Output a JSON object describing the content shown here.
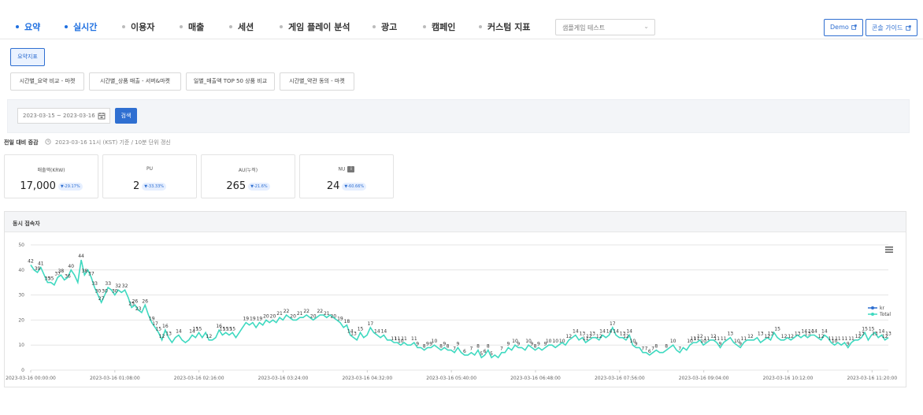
{
  "nav": {
    "items": [
      {
        "label": "요약",
        "active": true
      },
      {
        "label": "실시간",
        "active": true
      },
      {
        "label": "이용자",
        "active": false
      },
      {
        "label": "매출",
        "active": false
      },
      {
        "label": "세션",
        "active": false
      },
      {
        "label": "게임 플레이 분석",
        "active": false
      },
      {
        "label": "광고",
        "active": false
      },
      {
        "label": "캠페인",
        "active": false
      },
      {
        "label": "커스텀 지표",
        "active": false
      }
    ],
    "project_select": "샘플게임 테스트",
    "demo_label": "Demo",
    "guide_label": "콘솔 가이드"
  },
  "summary_button": "요약지표",
  "report_buttons": [
    "시간별_요약 비교 - 마켓",
    "시간별_상품 매출 - 서버&마켓",
    "일별_매출액 TOP 50 상품 비교",
    "시간별_약관 동의 - 마켓"
  ],
  "filter": {
    "date_range": "2023-03-15 ~ 2023-03-16",
    "search_label": "검색"
  },
  "compare": {
    "title": "전일 대비 증감",
    "note": "2023-03-16 11시 (KST) 기준 / 10분 단위 갱신"
  },
  "kpis": [
    {
      "label": "매출액(KRW)",
      "value": "17,000",
      "change": "▼-29.17%",
      "info": false
    },
    {
      "label": "PU",
      "value": "2",
      "change": "▼-33.33%",
      "info": false
    },
    {
      "label": "AU(누적)",
      "value": "265",
      "change": "▼-21.6%",
      "info": false
    },
    {
      "label": "NU",
      "value": "24",
      "change": "▼-60.66%",
      "info": true
    }
  ],
  "chart_data": {
    "type": "line",
    "title": "동시 접속자",
    "ylim": [
      0,
      50
    ],
    "yticks": [
      0,
      10,
      20,
      30,
      40,
      50
    ],
    "xtick_labels": [
      "2023-03-16 00:00:00",
      "2023-03-16 01:08:00",
      "2023-03-16 02:16:00",
      "2023-03-16 03:24:00",
      "2023-03-16 04:32:00",
      "2023-03-16 05:40:00",
      "2023-03-16 06:48:00",
      "2023-03-16 07:56:00",
      "2023-03-16 09:04:00",
      "2023-03-16 10:12:00",
      "2023-03-16 11:20:00"
    ],
    "legend": [
      "kr",
      "Total"
    ],
    "legend_position": "right",
    "grid": true,
    "colors": {
      "kr": "#2f6fd1",
      "Total": "#3fd9c0"
    },
    "series": [
      {
        "name": "Total",
        "values": [
          42,
          40,
          39,
          41,
          38,
          35,
          35,
          34,
          37,
          38,
          36,
          37,
          40,
          38,
          35,
          44,
          38,
          40,
          37,
          33,
          30,
          27,
          30,
          33,
          32,
          30,
          32,
          31,
          32,
          29,
          25,
          26,
          24,
          23,
          26,
          22,
          19,
          17,
          15,
          12,
          16,
          13,
          11,
          13,
          14,
          12,
          11,
          12,
          14,
          13,
          15,
          13,
          15,
          12,
          12,
          13,
          16,
          14,
          15,
          14,
          15,
          13,
          15,
          17,
          19,
          18,
          19,
          17,
          19,
          18,
          20,
          19,
          20,
          19,
          21,
          20,
          22,
          21,
          20,
          20,
          21,
          21,
          22,
          21,
          20,
          21,
          22,
          22,
          21,
          22,
          21,
          20,
          19,
          17,
          18,
          14,
          13,
          12,
          15,
          13,
          14,
          17,
          15,
          14,
          13,
          14,
          12,
          12,
          11,
          11,
          10,
          11,
          10,
          10,
          11,
          9,
          9,
          8,
          9,
          9,
          10,
          9,
          8,
          9,
          8,
          8,
          7,
          9,
          7,
          6,
          6,
          7,
          6,
          8,
          5,
          6,
          8,
          5,
          6,
          5,
          7,
          7,
          9,
          8,
          10,
          9,
          9,
          8,
          10,
          9,
          8,
          9,
          8,
          9,
          10,
          10,
          9,
          10,
          11,
          10,
          12,
          13,
          14,
          12,
          13,
          11,
          12,
          13,
          13,
          12,
          14,
          13,
          14,
          17,
          14,
          13,
          13,
          12,
          14,
          10,
          9,
          9,
          7,
          7,
          6,
          7,
          8,
          7,
          7,
          8,
          9,
          10,
          8,
          7,
          9,
          8,
          10,
          11,
          11,
          12,
          10,
          11,
          12,
          12,
          11,
          9,
          11,
          12,
          13,
          11,
          10,
          9,
          11,
          12,
          12,
          12,
          13,
          11,
          12,
          13,
          12,
          15,
          13,
          12,
          12,
          13,
          12,
          13,
          14,
          13,
          14,
          13,
          14,
          14,
          13,
          12,
          14,
          13,
          11,
          10,
          11,
          10,
          11,
          9,
          11,
          12,
          12,
          13,
          15,
          12,
          14,
          15,
          13,
          14,
          12,
          13
        ]
      },
      {
        "name": "kr",
        "values": []
      }
    ],
    "point_labels": [
      {
        "i": 0,
        "v": 42
      },
      {
        "i": 2,
        "v": 39
      },
      {
        "i": 3,
        "v": 41
      },
      {
        "i": 5,
        "v": 35
      },
      {
        "i": 6,
        "v": 35
      },
      {
        "i": 8,
        "v": 37
      },
      {
        "i": 9,
        "v": 38
      },
      {
        "i": 11,
        "v": 36
      },
      {
        "i": 12,
        "v": 40
      },
      {
        "i": 15,
        "v": 44
      },
      {
        "i": 16,
        "v": 38
      },
      {
        "i": 18,
        "v": 37
      },
      {
        "i": 19,
        "v": 33
      },
      {
        "i": 20,
        "v": 30
      },
      {
        "i": 21,
        "v": 27
      },
      {
        "i": 22,
        "v": 30
      },
      {
        "i": 23,
        "v": 33
      },
      {
        "i": 25,
        "v": 30
      },
      {
        "i": 26,
        "v": 32
      },
      {
        "i": 28,
        "v": 32
      },
      {
        "i": 30,
        "v": 25
      },
      {
        "i": 31,
        "v": 26
      },
      {
        "i": 32,
        "v": 23
      },
      {
        "i": 34,
        "v": 26
      },
      {
        "i": 36,
        "v": 19
      },
      {
        "i": 37,
        "v": 17
      },
      {
        "i": 38,
        "v": 15
      },
      {
        "i": 39,
        "v": 12
      },
      {
        "i": 40,
        "v": 16
      },
      {
        "i": 41,
        "v": 13
      },
      {
        "i": 44,
        "v": 14
      },
      {
        "i": 48,
        "v": 14
      },
      {
        "i": 49,
        "v": 15
      },
      {
        "i": 50,
        "v": 15
      },
      {
        "i": 53,
        "v": 12
      },
      {
        "i": 56,
        "v": 16
      },
      {
        "i": 57,
        "v": 15
      },
      {
        "i": 58,
        "v": 15
      },
      {
        "i": 59,
        "v": 15
      },
      {
        "i": 60,
        "v": 15
      },
      {
        "i": 64,
        "v": 19
      },
      {
        "i": 66,
        "v": 19
      },
      {
        "i": 68,
        "v": 19
      },
      {
        "i": 70,
        "v": 20
      },
      {
        "i": 72,
        "v": 20
      },
      {
        "i": 74,
        "v": 21
      },
      {
        "i": 76,
        "v": 22
      },
      {
        "i": 78,
        "v": 20
      },
      {
        "i": 80,
        "v": 21
      },
      {
        "i": 82,
        "v": 22
      },
      {
        "i": 84,
        "v": 20
      },
      {
        "i": 86,
        "v": 22
      },
      {
        "i": 88,
        "v": 21
      },
      {
        "i": 90,
        "v": 20
      },
      {
        "i": 92,
        "v": 19
      },
      {
        "i": 94,
        "v": 18
      },
      {
        "i": 95,
        "v": 14
      },
      {
        "i": 96,
        "v": 13
      },
      {
        "i": 98,
        "v": 15
      },
      {
        "i": 101,
        "v": 17
      },
      {
        "i": 103,
        "v": 14
      },
      {
        "i": 105,
        "v": 14
      },
      {
        "i": 108,
        "v": 11
      },
      {
        "i": 109,
        "v": 11
      },
      {
        "i": 110,
        "v": 10
      },
      {
        "i": 111,
        "v": 11
      },
      {
        "i": 114,
        "v": 11
      },
      {
        "i": 115,
        "v": 9
      },
      {
        "i": 117,
        "v": 8
      },
      {
        "i": 118,
        "v": 9
      },
      {
        "i": 119,
        "v": 9
      },
      {
        "i": 120,
        "v": 10
      },
      {
        "i": 122,
        "v": 8
      },
      {
        "i": 123,
        "v": 9
      },
      {
        "i": 124,
        "v": 8
      },
      {
        "i": 126,
        "v": 7
      },
      {
        "i": 127,
        "v": 9
      },
      {
        "i": 129,
        "v": 6
      },
      {
        "i": 131,
        "v": 7
      },
      {
        "i": 133,
        "v": 8
      },
      {
        "i": 134,
        "v": 5
      },
      {
        "i": 135,
        "v": 6
      },
      {
        "i": 136,
        "v": 8
      },
      {
        "i": 137,
        "v": 5
      },
      {
        "i": 140,
        "v": 7
      },
      {
        "i": 142,
        "v": 9
      },
      {
        "i": 144,
        "v": 10
      },
      {
        "i": 145,
        "v": 9
      },
      {
        "i": 148,
        "v": 10
      },
      {
        "i": 149,
        "v": 9
      },
      {
        "i": 150,
        "v": 8
      },
      {
        "i": 151,
        "v": 9
      },
      {
        "i": 153,
        "v": 9
      },
      {
        "i": 154,
        "v": 10
      },
      {
        "i": 156,
        "v": 10
      },
      {
        "i": 158,
        "v": 10
      },
      {
        "i": 160,
        "v": 12
      },
      {
        "i": 162,
        "v": 14
      },
      {
        "i": 164,
        "v": 13
      },
      {
        "i": 165,
        "v": 11
      },
      {
        "i": 166,
        "v": 12
      },
      {
        "i": 167,
        "v": 13
      },
      {
        "i": 169,
        "v": 12
      },
      {
        "i": 170,
        "v": 14
      },
      {
        "i": 172,
        "v": 14
      },
      {
        "i": 173,
        "v": 17
      },
      {
        "i": 174,
        "v": 14
      },
      {
        "i": 176,
        "v": 13
      },
      {
        "i": 177,
        "v": 12
      },
      {
        "i": 178,
        "v": 14
      },
      {
        "i": 179,
        "v": 10
      },
      {
        "i": 180,
        "v": 9
      },
      {
        "i": 182,
        "v": 7
      },
      {
        "i": 183,
        "v": 7
      },
      {
        "i": 184,
        "v": 6
      },
      {
        "i": 185,
        "v": 7
      },
      {
        "i": 186,
        "v": 8
      },
      {
        "i": 189,
        "v": 8
      },
      {
        "i": 191,
        "v": 10
      },
      {
        "i": 193,
        "v": 7
      },
      {
        "i": 196,
        "v": 10
      },
      {
        "i": 197,
        "v": 11
      },
      {
        "i": 198,
        "v": 11
      },
      {
        "i": 199,
        "v": 12
      },
      {
        "i": 200,
        "v": 10
      },
      {
        "i": 201,
        "v": 11
      },
      {
        "i": 203,
        "v": 12
      },
      {
        "i": 204,
        "v": 11
      },
      {
        "i": 205,
        "v": 9
      },
      {
        "i": 206,
        "v": 11
      },
      {
        "i": 208,
        "v": 13
      },
      {
        "i": 210,
        "v": 10
      },
      {
        "i": 211,
        "v": 9
      },
      {
        "i": 212,
        "v": 11
      },
      {
        "i": 214,
        "v": 12
      },
      {
        "i": 217,
        "v": 13
      },
      {
        "i": 219,
        "v": 12
      },
      {
        "i": 220,
        "v": 13
      },
      {
        "i": 222,
        "v": 15
      },
      {
        "i": 224,
        "v": 12
      },
      {
        "i": 226,
        "v": 12
      },
      {
        "i": 228,
        "v": 13
      },
      {
        "i": 230,
        "v": 14
      },
      {
        "i": 231,
        "v": 13
      },
      {
        "i": 232,
        "v": 14
      },
      {
        "i": 233,
        "v": 14
      },
      {
        "i": 235,
        "v": 12
      },
      {
        "i": 236,
        "v": 14
      },
      {
        "i": 238,
        "v": 11
      },
      {
        "i": 239,
        "v": 10
      },
      {
        "i": 240,
        "v": 11
      },
      {
        "i": 242,
        "v": 11
      },
      {
        "i": 243,
        "v": 9
      },
      {
        "i": 244,
        "v": 11
      },
      {
        "i": 246,
        "v": 12
      },
      {
        "i": 247,
        "v": 13
      },
      {
        "i": 248,
        "v": 15
      },
      {
        "i": 250,
        "v": 15
      },
      {
        "i": 251,
        "v": 13
      },
      {
        "i": 253,
        "v": 14
      },
      {
        "i": 254,
        "v": 12
      },
      {
        "i": 255,
        "v": 13
      }
    ]
  }
}
